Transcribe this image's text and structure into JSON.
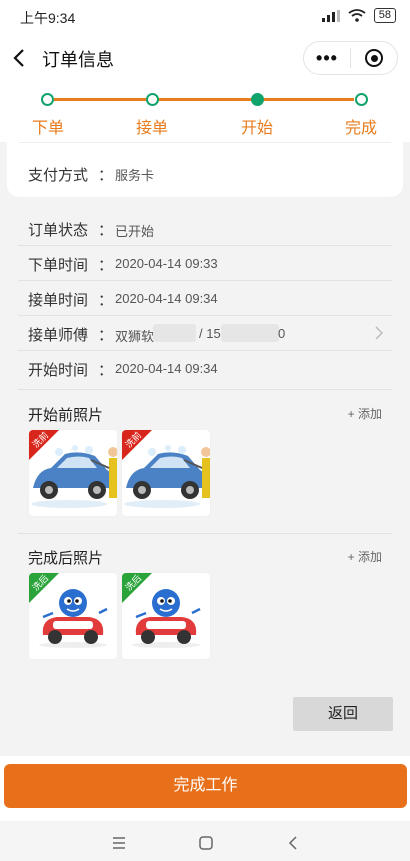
{
  "status_bar": {
    "time": "上午9:34",
    "signal": "signal-icon",
    "wifi": "wifi-icon",
    "battery": "58"
  },
  "header": {
    "title": "订单信息",
    "more_icon": "more-dots-icon",
    "close_icon": "target-icon"
  },
  "steps": [
    {
      "label": "下单",
      "state": "done"
    },
    {
      "label": "接单",
      "state": "done"
    },
    {
      "label": "开始",
      "state": "current"
    },
    {
      "label": "完成",
      "state": "pending"
    }
  ],
  "payment": {
    "label": "支付方式",
    "colon": "：",
    "value": "服务卡"
  },
  "info_rows": [
    {
      "label": "订单状态",
      "colon": "：",
      "value": "已开始"
    },
    {
      "label": "下单时间",
      "colon": "：",
      "value": "2020-04-14 09:33"
    },
    {
      "label": "接单时间",
      "colon": "：",
      "value": "2020-04-14 09:34"
    },
    {
      "label": "接单师傅",
      "colon": "：",
      "value_a": "双狮软",
      "value_sep": "/ 15",
      "value_b": "0"
    },
    {
      "label": "开始时间",
      "colon": "：",
      "value": "2020-04-14 09:34"
    }
  ],
  "before_photos": {
    "title": "开始前照片",
    "add": "+ 添加",
    "tag": "洗前",
    "count": 2
  },
  "after_photos": {
    "title": "完成后照片",
    "add": "+ 添加",
    "tag": "洗后",
    "count": 2
  },
  "actions": {
    "back": "返回",
    "finish": "完成工作"
  },
  "colors": {
    "accent": "#e87c1e",
    "green": "#11a36c",
    "before_tag": "#d9261c",
    "after_tag": "#2aa33a"
  }
}
